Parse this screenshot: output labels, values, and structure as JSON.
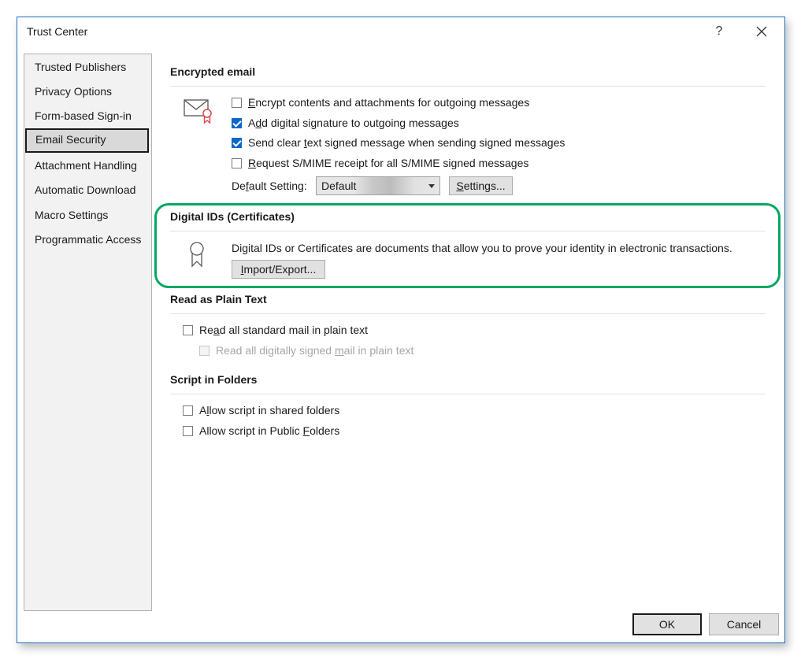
{
  "window": {
    "title": "Trust Center",
    "help_label": "?",
    "close_label": "✕"
  },
  "sidebar": {
    "items": [
      {
        "label": "Trusted Publishers",
        "selected": false
      },
      {
        "label": "Privacy Options",
        "selected": false
      },
      {
        "label": "Form-based Sign-in",
        "selected": false
      },
      {
        "label": "Email Security",
        "selected": true
      },
      {
        "label": "Attachment Handling",
        "selected": false
      },
      {
        "label": "Automatic Download",
        "selected": false
      },
      {
        "label": "Macro Settings",
        "selected": false
      },
      {
        "label": "Programmatic Access",
        "selected": false
      }
    ]
  },
  "encrypted_email": {
    "heading": "Encrypted email",
    "icon": "envelope-certificate-icon",
    "options": [
      {
        "pre": "",
        "key": "E",
        "post": "ncrypt contents and attachments for outgoing messages",
        "checked": false
      },
      {
        "pre": "A",
        "key": "d",
        "post": "d digital signature to outgoing messages",
        "checked": true
      },
      {
        "pre": "Send clear ",
        "key": "t",
        "post": "ext signed message when sending signed messages",
        "checked": true
      },
      {
        "pre": "",
        "key": "R",
        "post": "equest S/MIME receipt for all S/MIME signed messages",
        "checked": false
      }
    ],
    "default_setting": {
      "label_pre": "De",
      "label_key": "f",
      "label_post": "ault Setting:",
      "value": "Default"
    },
    "settings_button": {
      "key": "S",
      "post": "ettings..."
    }
  },
  "digital_ids": {
    "heading": "Digital IDs (Certificates)",
    "icon": "certificate-ribbon-icon",
    "description": "Digital IDs or Certificates are documents that allow you to prove your identity in electronic transactions.",
    "import_export_button": {
      "key": "I",
      "post": "mport/Export..."
    },
    "highlight_color": "#00a862"
  },
  "read_plain_text": {
    "heading": "Read as Plain Text",
    "options": [
      {
        "pre": "Re",
        "key": "a",
        "post": "d all standard mail in plain text",
        "checked": false,
        "disabled": false
      },
      {
        "pre": "Read all digitally signed ",
        "key": "m",
        "post": "ail in plain text",
        "checked": false,
        "disabled": true
      }
    ]
  },
  "script_in_folders": {
    "heading": "Script in Folders",
    "options": [
      {
        "pre": "A",
        "key": "l",
        "post": "low script in shared folders",
        "checked": false
      },
      {
        "pre": "Allow script in Public ",
        "key": "F",
        "post": "olders",
        "checked": false
      }
    ]
  },
  "footer": {
    "ok_label": "OK",
    "cancel_label": "Cancel"
  },
  "colors": {
    "accent": "#0b67c8",
    "window_border": "#1f6fc1",
    "highlight": "#00a862"
  }
}
